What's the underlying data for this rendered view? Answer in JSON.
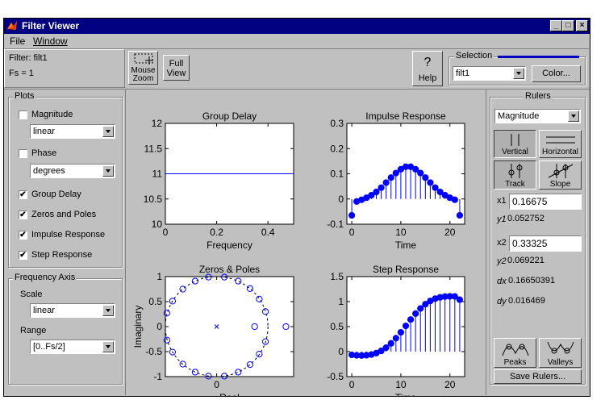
{
  "window": {
    "title": "Filter Viewer"
  },
  "menu": {
    "file": "File",
    "window": "Window"
  },
  "filter_info": {
    "filter": "Filter: filt1",
    "fs": "Fs = 1"
  },
  "toolbar": {
    "mouse_zoom": [
      "Mouse",
      "Zoom"
    ],
    "full_view": [
      "Full",
      "View"
    ],
    "help_symbol": "?",
    "help": "Help"
  },
  "selection": {
    "title": "Selection",
    "selected": "filt1",
    "color_button": "Color...",
    "line_color": "#0000c0"
  },
  "plots_panel": {
    "title": "Plots",
    "magnitude": {
      "label": "Magnitude",
      "checked": false,
      "scale": "linear"
    },
    "phase": {
      "label": "Phase",
      "checked": false,
      "units": "degrees"
    },
    "group_delay": {
      "label": "Group Delay",
      "checked": true
    },
    "zeros_poles": {
      "label": "Zeros and Poles",
      "checked": true
    },
    "impulse": {
      "label": "Impulse Response",
      "checked": true
    },
    "step": {
      "label": "Step Response",
      "checked": true
    },
    "check_mark": "✔"
  },
  "freq_axis": {
    "title": "Frequency Axis",
    "scale_label": "Scale",
    "scale_value": "linear",
    "range_label": "Range",
    "range_value": "[0..Fs/2]"
  },
  "rulers": {
    "title": "Rulers",
    "mode": "Magnitude",
    "vertical": "Vertical",
    "horizontal": "Horizontal",
    "track": "Track",
    "slope": "Slope",
    "x1_label": "x1",
    "x1_value": "0.16675",
    "y1_label": "y1",
    "y1_value": "0.052752",
    "x2_label": "x2",
    "x2_value": "0.33325",
    "y2_label": "y2",
    "y2_value": "0.069221",
    "dx_label": "dx",
    "dx_value": "0.16650391",
    "dy_label": "dy",
    "dy_value": "0.016469",
    "peaks": "Peaks",
    "valleys": "Valleys",
    "save": "Save Rulers..."
  },
  "colors": {
    "plot_blue": "#0000ff",
    "title_bar": "#000080",
    "face": "#c0c0c0"
  },
  "chart_data": [
    {
      "type": "line",
      "title": "Group Delay",
      "xlabel": "Frequency",
      "ylabel": "",
      "xlim": [
        0,
        0.5
      ],
      "ylim": [
        10,
        12
      ],
      "xticks": [
        "0",
        "0.2",
        "0.4"
      ],
      "xtick_values": [
        0,
        0.2,
        0.4
      ],
      "yticks": [
        "10",
        "10.5",
        "11",
        "11.5",
        "12"
      ],
      "ytick_values": [
        10,
        10.5,
        11,
        11.5,
        12
      ],
      "x": [
        0,
        0.5
      ],
      "y": [
        11,
        11
      ]
    },
    {
      "type": "scatter",
      "title": "Impulse Response",
      "xlabel": "Time",
      "ylabel": "",
      "stem": true,
      "xlim": [
        -1,
        23
      ],
      "ylim": [
        -0.1,
        0.3
      ],
      "xticks": [
        "0",
        "10",
        "20"
      ],
      "xtick_values": [
        0,
        10,
        20
      ],
      "yticks": [
        "-0.1",
        "0",
        "0.1",
        "0.2",
        "0.3"
      ],
      "ytick_values": [
        -0.1,
        0,
        0.1,
        0.2,
        0.3
      ],
      "x": [
        0,
        1,
        2,
        3,
        4,
        5,
        6,
        7,
        8,
        9,
        10,
        11,
        12,
        13,
        14,
        15,
        16,
        17,
        18,
        19,
        20,
        21,
        22
      ],
      "y": [
        -0.065,
        -0.01,
        -0.003,
        0.005,
        0.015,
        0.028,
        0.045,
        0.065,
        0.085,
        0.103,
        0.118,
        0.128,
        0.128,
        0.118,
        0.103,
        0.085,
        0.065,
        0.045,
        0.028,
        0.015,
        0.005,
        -0.003,
        -0.065
      ]
    },
    {
      "type": "scatter",
      "title": "Zeros & Poles",
      "xlabel": "Real",
      "ylabel": "Imaginary",
      "xlim": [
        -1,
        1.5
      ],
      "ylim": [
        -1,
        1
      ],
      "xticks": [
        "0"
      ],
      "xtick_values": [
        0
      ],
      "yticks": [
        "-1",
        "-0.5",
        "0",
        "0.5",
        "1"
      ],
      "ytick_values": [
        -1,
        -0.5,
        0,
        0.5,
        1
      ],
      "unit_circle": true,
      "zeros": [
        [
          -0.97,
          0.27
        ],
        [
          -0.97,
          -0.27
        ],
        [
          -0.86,
          0.51
        ],
        [
          -0.86,
          -0.51
        ],
        [
          -0.66,
          0.75
        ],
        [
          -0.66,
          -0.75
        ],
        [
          -0.42,
          0.91
        ],
        [
          -0.42,
          -0.91
        ],
        [
          -0.16,
          0.99
        ],
        [
          -0.16,
          -0.99
        ],
        [
          0.15,
          0.99
        ],
        [
          0.15,
          -0.99
        ],
        [
          0.42,
          0.91
        ],
        [
          0.42,
          -0.91
        ],
        [
          0.65,
          0.76
        ],
        [
          0.65,
          -0.76
        ],
        [
          0.83,
          0.55
        ],
        [
          0.83,
          -0.55
        ],
        [
          0.95,
          0.3
        ],
        [
          0.95,
          -0.3
        ],
        [
          0.74,
          0
        ],
        [
          1.35,
          0
        ]
      ],
      "poles": [
        [
          0,
          0
        ]
      ]
    },
    {
      "type": "scatter",
      "title": "Step Response",
      "xlabel": "Time",
      "ylabel": "",
      "stem": true,
      "xlim": [
        -1,
        23
      ],
      "ylim": [
        -0.5,
        1.5
      ],
      "xticks": [
        "0",
        "10",
        "20"
      ],
      "xtick_values": [
        0,
        10,
        20
      ],
      "yticks": [
        "-0.5",
        "0",
        "0.5",
        "1",
        "1.5"
      ],
      "ytick_values": [
        -0.5,
        0,
        0.5,
        1,
        1.5
      ],
      "x": [
        0,
        1,
        2,
        3,
        4,
        5,
        6,
        7,
        8,
        9,
        10,
        11,
        12,
        13,
        14,
        15,
        16,
        17,
        18,
        19,
        20,
        21,
        22
      ],
      "y": [
        -0.065,
        -0.075,
        -0.078,
        -0.073,
        -0.058,
        -0.03,
        0.015,
        0.08,
        0.165,
        0.268,
        0.386,
        0.514,
        0.642,
        0.76,
        0.863,
        0.948,
        1.013,
        1.058,
        1.086,
        1.101,
        1.106,
        1.103,
        1.038
      ]
    }
  ]
}
